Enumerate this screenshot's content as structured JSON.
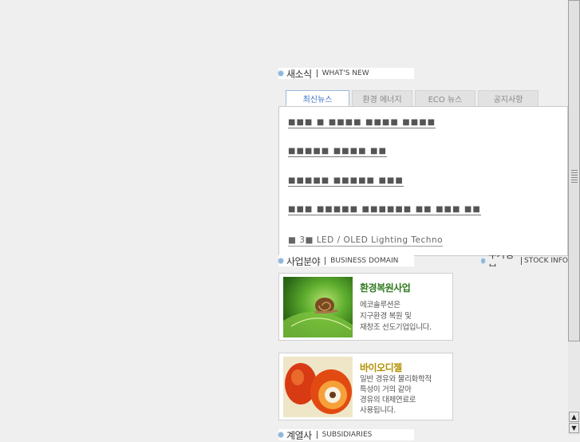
{
  "whats_new": {
    "title_ko": "새소식",
    "title_en": "WHAT'S NEW"
  },
  "tabs": [
    {
      "label": "최신뉴스",
      "active": true
    },
    {
      "label": "환경 에너지",
      "active": false
    },
    {
      "label": "ECO 뉴스",
      "active": false
    },
    {
      "label": "공지사항",
      "active": false
    }
  ],
  "news": [
    "■■■ ■ ■■■■ ■■■■ ■■■■",
    "■■■■■ ■■■■ ■■",
    "■■■■■ ■■■■■ ■■■",
    "■■■ ■■■■■ ■■■■■■ ■■ ■■■ ■■",
    "■ 3■  LED / OLED Lighting Techno"
  ],
  "business": {
    "title_ko": "사업분야",
    "title_en": "BUSINESS DOMAIN"
  },
  "stock": {
    "title_ko": "주가정보",
    "title_en": "STOCK INFO"
  },
  "cards": [
    {
      "title": "환경복원사업",
      "title_color": "#2f7a1f",
      "lines": [
        "에코솔루션은",
        "지구환경 복원 및",
        "재창조 선도기업입니다."
      ]
    },
    {
      "title": "바이오디젤",
      "title_color": "#b09000",
      "lines": [
        "일반 경유와 물리화학적",
        "특성이 거의 같아",
        "경유의 대체연료로",
        "사용됩니다."
      ]
    }
  ],
  "subsidiaries": {
    "title_ko": "계열사",
    "title_en": "SUBSIDIARIES"
  },
  "scrollbar": {
    "up_icon": "▲",
    "down_icon": "▼"
  }
}
